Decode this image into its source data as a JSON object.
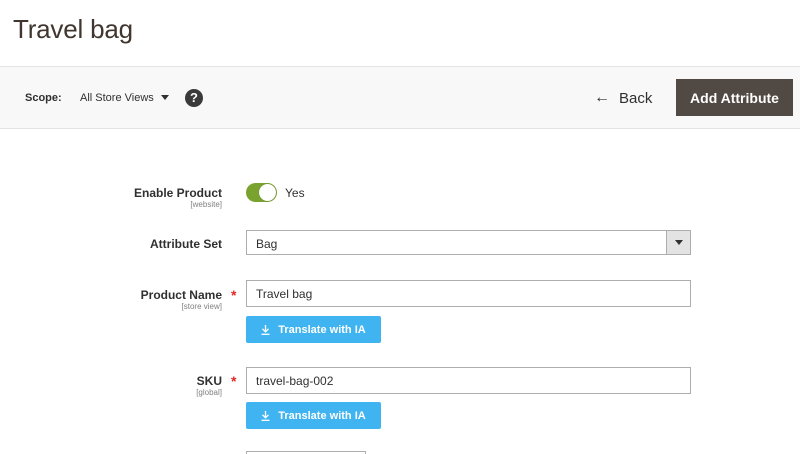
{
  "page": {
    "title": "Travel bag"
  },
  "toolbar": {
    "scope_label": "Scope:",
    "scope_value": "All Store Views",
    "help_icon": "?",
    "back_label": "Back",
    "back_icon": "←",
    "add_attribute_label": "Add Attribute"
  },
  "form": {
    "enable_product": {
      "label": "Enable Product",
      "scope": "[website]",
      "value": "Yes",
      "enabled": true
    },
    "attribute_set": {
      "label": "Attribute Set",
      "value": "Bag"
    },
    "product_name": {
      "label": "Product Name",
      "scope": "[store view]",
      "value": "Travel bag",
      "required_mark": "*",
      "translate_label": "Translate with IA"
    },
    "sku": {
      "label": "SKU",
      "scope": "[global]",
      "value": "travel-bag-002",
      "required_mark": "*",
      "translate_label": "Translate with IA"
    }
  },
  "colors": {
    "accent_button": "#514943",
    "toggle_on": "#79a22e",
    "translate_button": "#40b4f1",
    "required": "#e22626"
  }
}
